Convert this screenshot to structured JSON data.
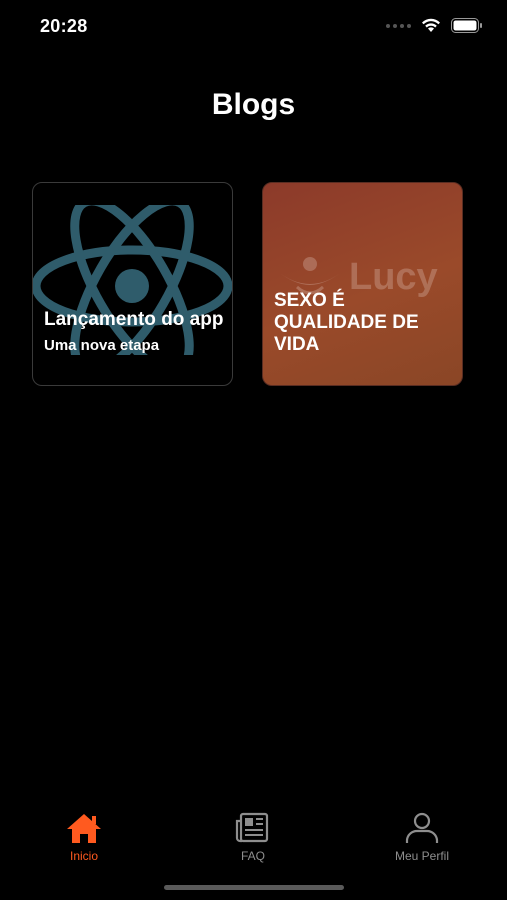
{
  "status_bar": {
    "time": "20:28"
  },
  "header": {
    "title": "Blogs"
  },
  "cards": [
    {
      "title": "Lançamento do app",
      "subtitle": "Uma nova etapa",
      "image": "react-logo"
    },
    {
      "title": "SEXO É QUALIDADE DE VIDA",
      "watermark": "Lucy",
      "image": "lucy-logo"
    }
  ],
  "tabs": [
    {
      "label": "Inicio",
      "icon": "home-icon",
      "active": true
    },
    {
      "label": "FAQ",
      "icon": "newspaper-icon",
      "active": false
    },
    {
      "label": "Meu Perfil",
      "icon": "user-icon",
      "active": false
    }
  ],
  "colors": {
    "accent": "#ff5a1f",
    "inactive": "#8e8e8e",
    "background": "#000000",
    "react_teal": "#2f5c6b"
  }
}
